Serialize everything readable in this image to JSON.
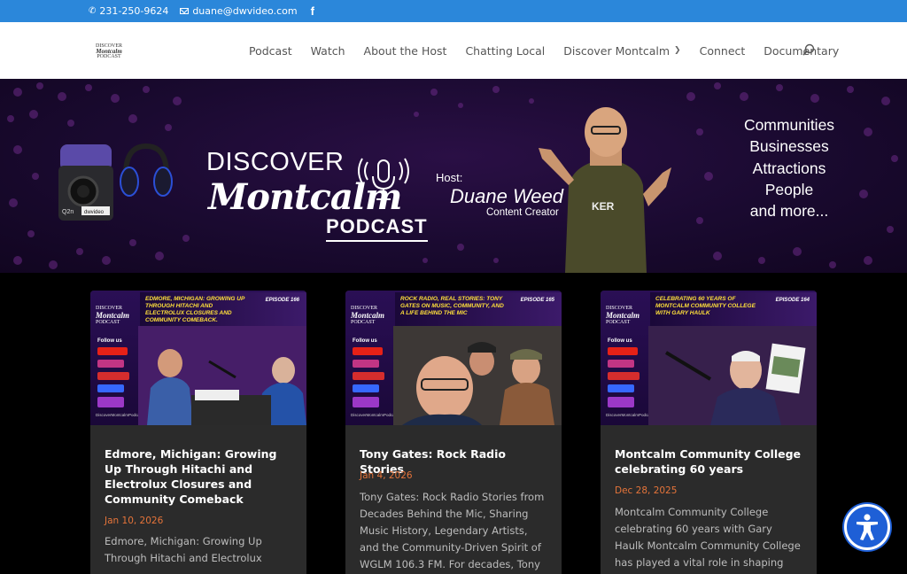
{
  "topbar": {
    "phone": "231-250-9624",
    "email": "duane@dwvideo.com",
    "icons": [
      "phone-icon",
      "mail-icon",
      "facebook-icon"
    ]
  },
  "header": {
    "logo_line1": "DISCOVER",
    "logo_line2": "Montcalm",
    "logo_line3": "PODCAST",
    "nav": [
      {
        "label": "Podcast"
      },
      {
        "label": "Watch"
      },
      {
        "label": "About the Host"
      },
      {
        "label": "Chatting Local"
      },
      {
        "label": "Discover Montcalm"
      },
      {
        "label": "Connect"
      },
      {
        "label": "Documentary"
      }
    ]
  },
  "hero": {
    "title": "DISCOVER",
    "brand": "Montcalm",
    "podcast": "PODCAST",
    "host_label": "Host:",
    "host_name": "Duane Weed",
    "host_role": "Content Creator",
    "recorder_label": "dwvideo",
    "taglines": [
      "Communities",
      "Businesses",
      "Attractions",
      "People",
      "and more..."
    ]
  },
  "cards": [
    {
      "banner": "Edmore, Michigan: Growing Up Through Hitachi and Electrolux Closures and Community Comeback.",
      "episode": "EPISODE 166",
      "title": "Edmore, Michigan: Growing Up Through Hitachi and Electrolux Closures and Community Comeback",
      "date": "Jan 10, 2026",
      "excerpt": "Edmore, Michigan: Growing Up Through Hitachi and Electrolux"
    },
    {
      "banner": "Rock Radio, Real Stories: Tony Gates on Music, Community, and a Life Behind the Mic",
      "episode": "EPISODE 165",
      "title": "Tony Gates: Rock Radio Stories",
      "date": "Jan 4, 2026",
      "excerpt": "Tony Gates: Rock Radio Stories from Decades Behind the Mic, Sharing Music History, Legendary Artists, and the Community-Driven Spirit of WGLM 106.3 FM. For decades, Tony Gates has"
    },
    {
      "banner": "Celebrating 60 years of Montcalm Community College with Gary Haulk",
      "episode": "EPISODE 164",
      "title": "Montcalm Community College celebrating 60 years",
      "date": "Dec 28, 2025",
      "excerpt": "Montcalm Community College celebrating 60 years with Gary Haulk Montcalm Community College has played a vital role in shaping"
    }
  ],
  "thumb_common": {
    "mini_logo_1": "DISCOVER",
    "mini_logo_2": "Montcalm",
    "mini_logo_3": "PODCAST",
    "follow": "Follow us",
    "url": "DiscoverMontcalmPodcast.com"
  },
  "colors": {
    "topbar": "#2b87da",
    "date": "#e5743a",
    "card_bg": "#2b2b2b",
    "a11y": "#1e5fd6"
  }
}
